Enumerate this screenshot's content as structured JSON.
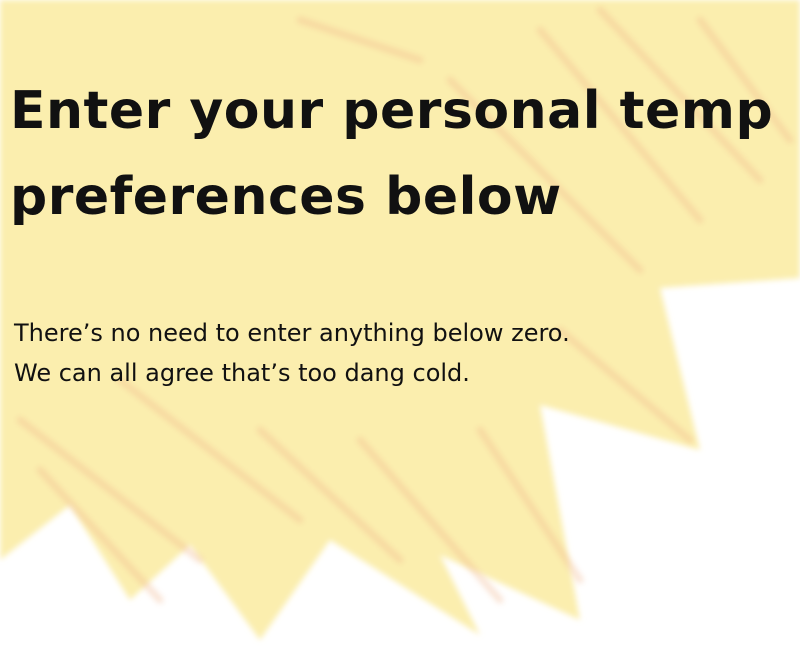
{
  "heading": {
    "line1": "Enter your personal temp",
    "line2": "preferences below"
  },
  "subtext": {
    "line1": "There’s no need to enter anything below zero.",
    "line2": "We can all agree that’s too dang cold."
  },
  "colors": {
    "background": "#ffffff",
    "sun_fill": "#fbeeae",
    "sun_strokes": "#f0b48a",
    "text": "#111111"
  }
}
